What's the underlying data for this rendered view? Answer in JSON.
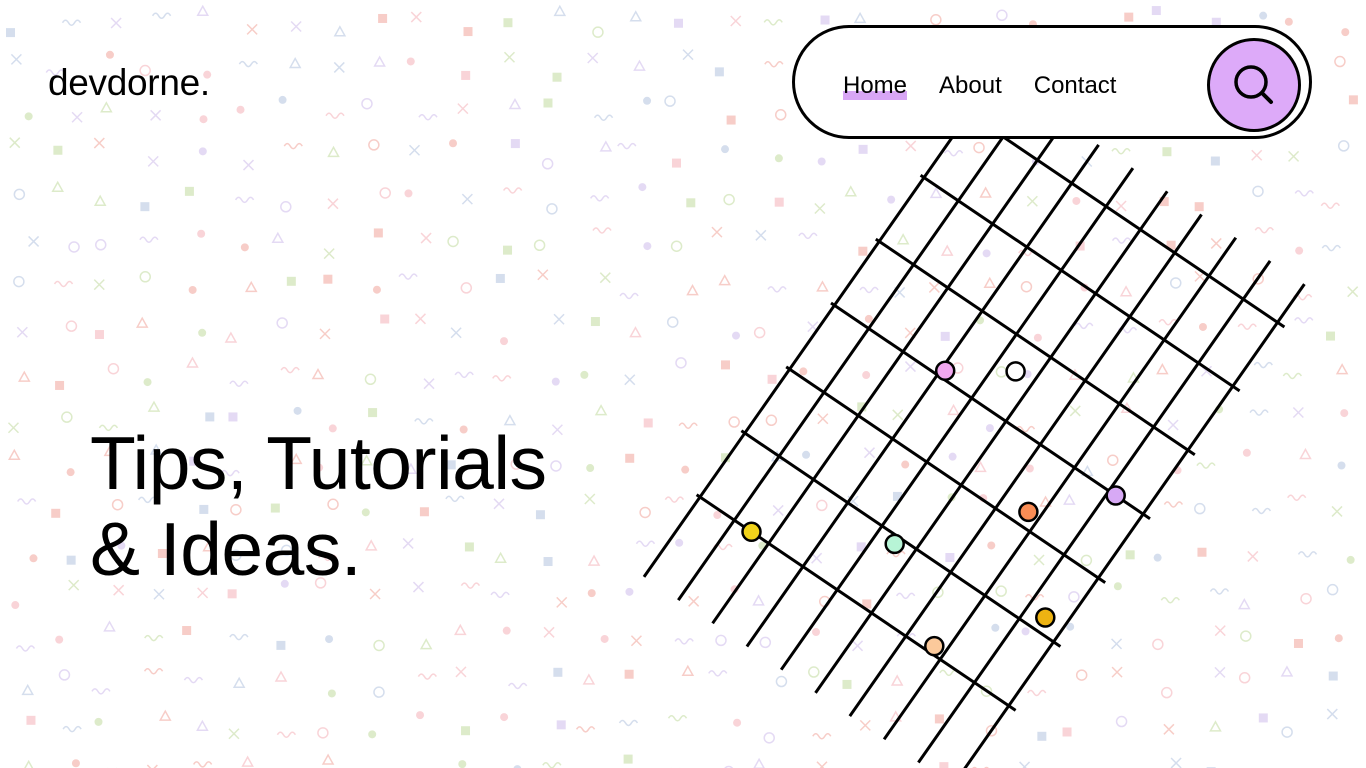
{
  "site": {
    "logo": "devdorne."
  },
  "nav": {
    "items": [
      {
        "label": "Home",
        "active": true
      },
      {
        "label": "About",
        "active": false
      },
      {
        "label": "Contact",
        "active": false
      }
    ],
    "search_icon": "search-icon"
  },
  "hero": {
    "line1": "Tips, Tutorials",
    "line2": "& Ideas."
  },
  "colors": {
    "accent": "#ddaaf9",
    "underline": "#d8a6f5",
    "dot_pink": "#f1a7ef",
    "dot_white": "#ffffff",
    "dot_purple": "#d7a9f5",
    "dot_orange": "#fa8d55",
    "dot_yellow": "#f1d31b",
    "dot_mint": "#b7f4d6",
    "dot_amber": "#edb312",
    "dot_peach": "#fbc99b"
  }
}
